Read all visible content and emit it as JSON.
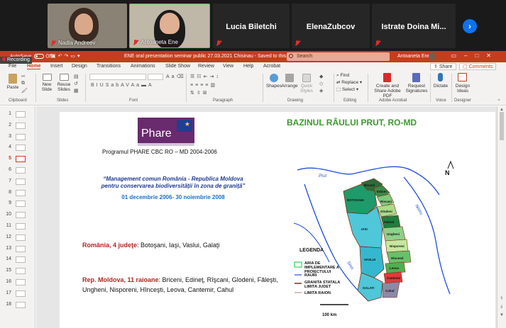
{
  "participants": [
    {
      "name": "Nadia Andreev",
      "video": true
    },
    {
      "name": "Antoaneta Ene",
      "video": true
    },
    {
      "name": "Lucia Biletchi",
      "video": false
    },
    {
      "name": "ElenaZubcov",
      "video": false
    },
    {
      "name": "Istrate Doina Mi...",
      "video": false
    }
  ],
  "recording": "Recording",
  "titlebar": {
    "autosave": "AutoSave",
    "autosave_state": "Off",
    "document": "ENE oral presentation seminar public 27.03.2021 Chisinau - Saved to this PC",
    "search_placeholder": "Search",
    "user": "Antoaneta Ene"
  },
  "tabs": [
    "File",
    "Home",
    "Insert",
    "Design",
    "Transitions",
    "Animations",
    "Slide Show",
    "Review",
    "View",
    "Help",
    "Acrobat"
  ],
  "active_tab": "Home",
  "share": "Share",
  "comments": "Comments",
  "ribbon": {
    "paste": "Paste",
    "new_slide": "New Slide",
    "reuse_slides": "Reuse Slides",
    "shapes": "Shapes",
    "arrange": "Arrange",
    "quick_styles": "Quick Styles",
    "find": "Find",
    "replace": "Replace",
    "select": "Select",
    "create_share_pdf": "Create and Share Adobe PDF",
    "request_signatures": "Request Signatures",
    "dictate": "Dictate",
    "design_ideas": "Design Ideas",
    "groups": {
      "clipboard": "Clipboard",
      "slides": "Slides",
      "font": "Font",
      "paragraph": "Paragraph",
      "drawing": "Drawing",
      "editing": "Editing",
      "adobe": "Adobe Acrobat",
      "voice": "Voice",
      "designer": "Designer"
    }
  },
  "thumbnails": [
    "1",
    "2",
    "3",
    "4",
    "5",
    "6",
    "7",
    "8",
    "9",
    "10",
    "11",
    "12",
    "13",
    "14",
    "15",
    "16",
    "17",
    "18"
  ],
  "active_slide": "5",
  "slide": {
    "logo_text": "Phare",
    "program": "Programul PHARE  CBC RO – MD 2004-2006",
    "title": "BAZINUL RÂULUI PRUT, RO-MD",
    "quote_line1": "“Management comun România - Republica Moldova",
    "quote_line2": "pentru conservarea biodiversităţii în zona de graniţă”",
    "dates": "01 decembrie 2006- 30 noiembrie 2008",
    "romania_label": "România,  4 judeţe",
    "romania_list": ": Botoşani, Iaşi, Vaslui, Galaţi",
    "moldova_label": "Rep. Moldova,  11 raioane",
    "moldova_list": ": Briceni, Edineţ, Rîşcani, Glodeni, Făleşti, Ungheni, Nisporeni, Hînceşti, Leova, Cantemir, Cahul",
    "legend": {
      "title": "LEGENDA",
      "area": "ARIA DE IMPLEMENTARE A PROIECTULUI",
      "rivers": "RAURI",
      "border": "GRANITA STATALA LIMITA JUDET",
      "district": "LIMITA RAION"
    },
    "scale": "100 km",
    "north": "N",
    "map_labels": {
      "botosani": "BOTOSANI",
      "iasi": "IASI",
      "vaslui": "VASLUI",
      "galati": "GALATI",
      "briceni": "Briceni",
      "edinet": "Edinet",
      "riscani": "Riscani",
      "glodeni": "Glodeni",
      "falesti": "Falesti",
      "ungheni": "Ungheni",
      "nisporeni": "Nisporeni",
      "hincesti": "Hincesti",
      "leova": "Leova",
      "cantemir": "Cantemir",
      "cahul": "Cahul",
      "prut": "Prut",
      "siret": "Siret",
      "nistru": "Nistru"
    }
  }
}
